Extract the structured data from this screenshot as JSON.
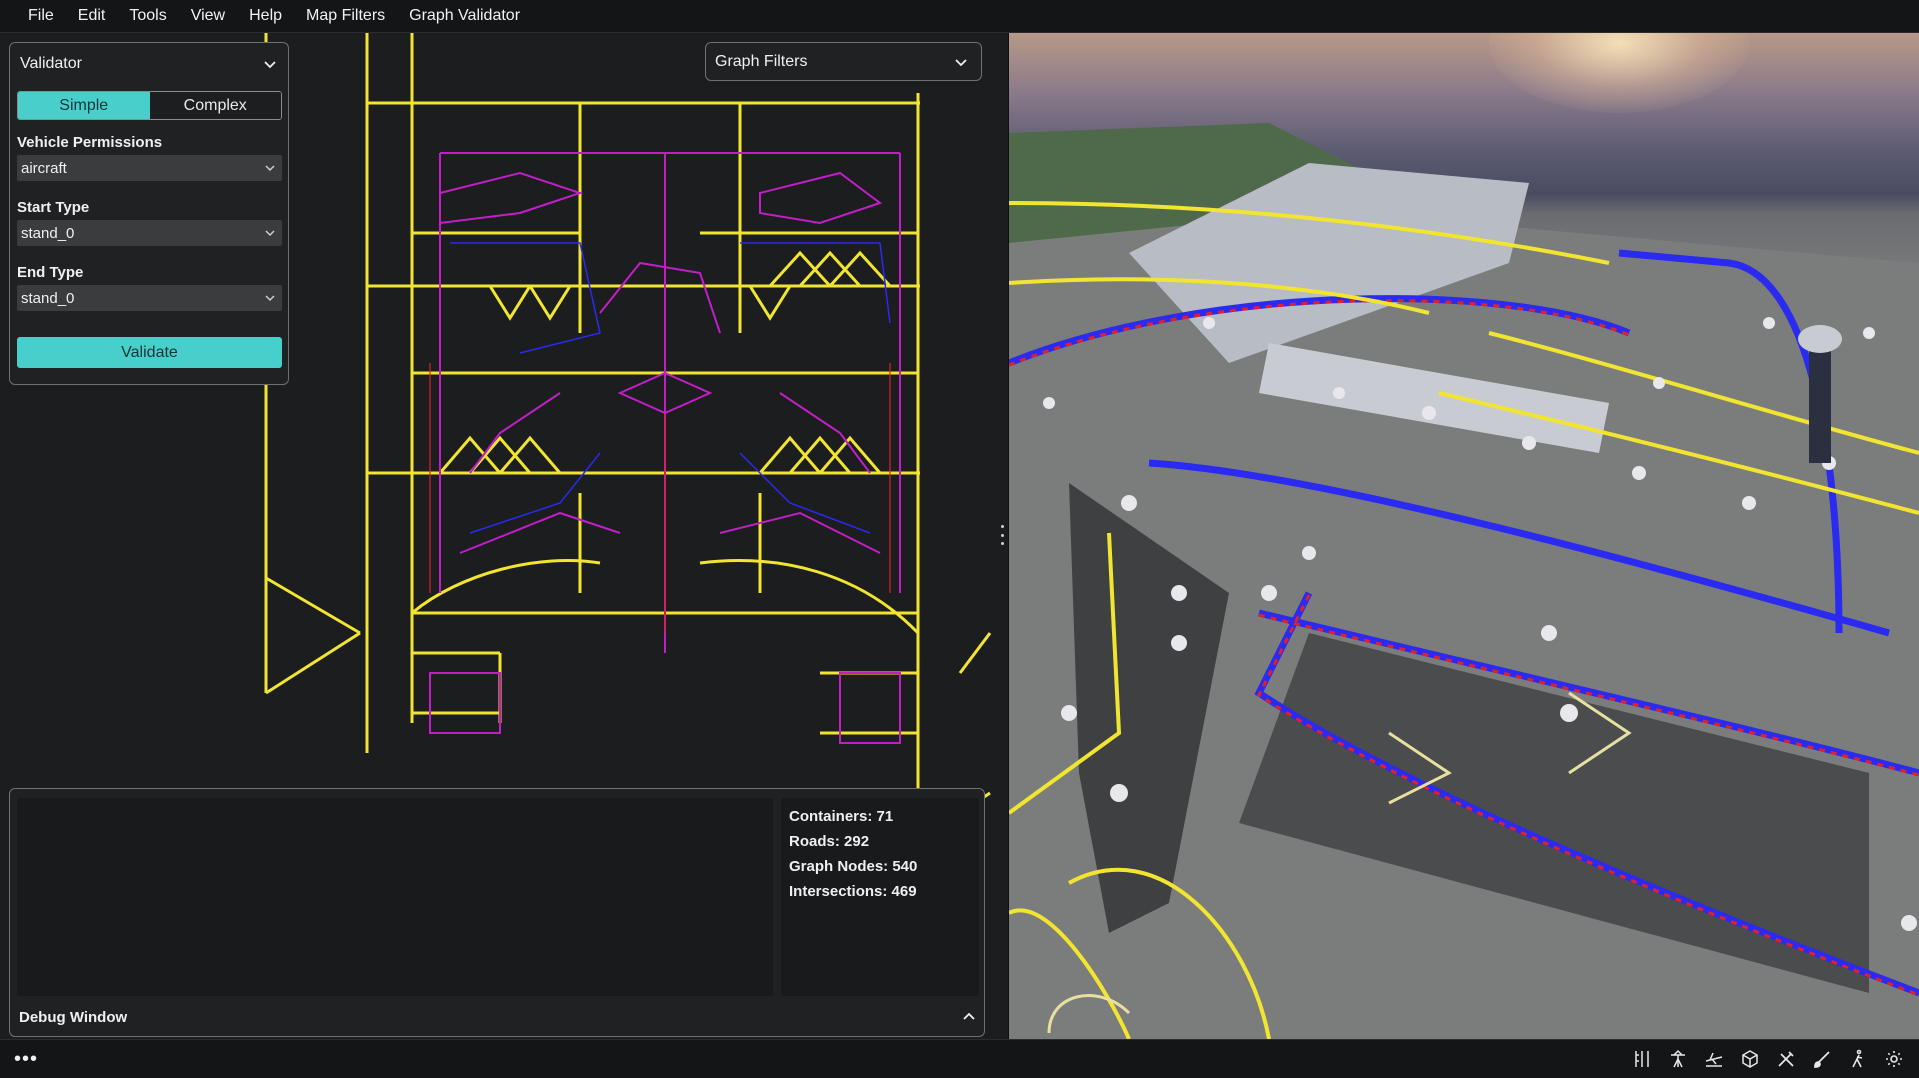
{
  "menubar": {
    "items": [
      "File",
      "Edit",
      "Tools",
      "View",
      "Help",
      "Map Filters",
      "Graph Validator"
    ]
  },
  "validator": {
    "title": "Validator",
    "mode_simple": "Simple",
    "mode_complex": "Complex",
    "active_mode": "Simple",
    "vehicle_permissions_label": "Vehicle Permissions",
    "vehicle_permissions_value": "aircraft",
    "start_type_label": "Start Type",
    "start_type_value": "stand_0",
    "end_type_label": "End Type",
    "end_type_value": "stand_0",
    "validate_label": "Validate"
  },
  "graph_filters": {
    "title": "Graph Filters"
  },
  "debug": {
    "title": "Debug Window",
    "stats": {
      "containers": "Containers: 71",
      "roads": "Roads: 292",
      "graph_nodes": "Graph Nodes: 540",
      "intersections": "Intersections: 469"
    }
  },
  "statusbar": {
    "more_label": "•••",
    "tool_icons": [
      "ruler-icon",
      "radio-tower-icon",
      "aircraft-icon",
      "cube-icon",
      "tools-icon",
      "brush-icon",
      "walk-icon",
      "gear-icon"
    ]
  },
  "colors": {
    "accent": "#48cfcb",
    "taxiway_yellow": "#f2e531",
    "route_magenta": "#c21ec8",
    "route_blue": "#2a2af0",
    "route_red": "#e0202a"
  }
}
